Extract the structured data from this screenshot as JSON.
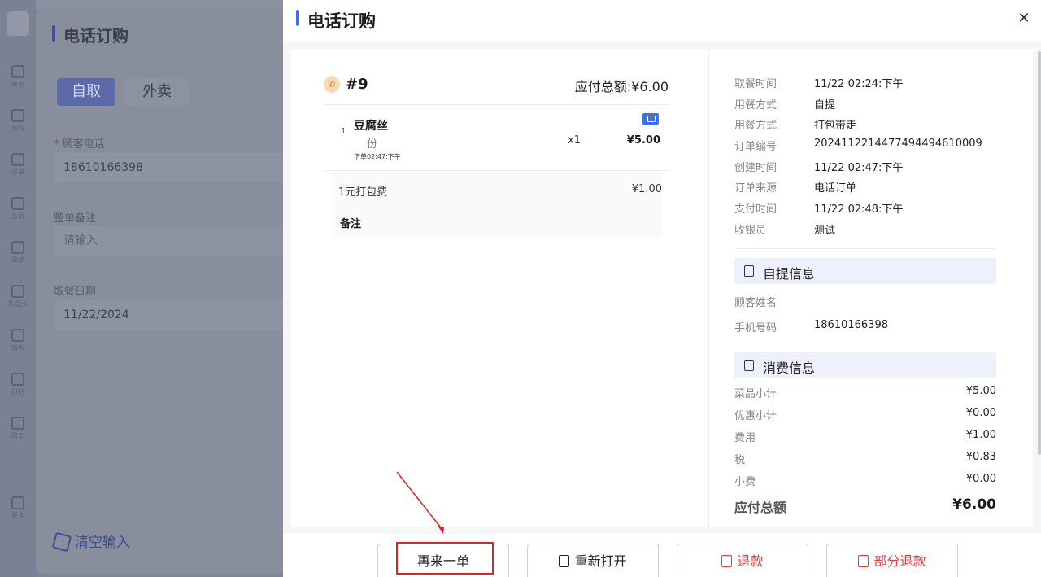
{
  "background": {
    "title": "电话订购",
    "tabs": [
      {
        "label": "自取",
        "active": true
      },
      {
        "label": "外卖",
        "active": false
      }
    ],
    "fields": [
      {
        "label": "顾客电话",
        "required": true,
        "value": "18610166398"
      },
      {
        "label": "整单备注",
        "required": false,
        "placeholder": "请输入"
      },
      {
        "label": "取餐日期",
        "required": false,
        "value": "11/22/2024"
      }
    ],
    "clear_label": "清空输入",
    "rail_items": [
      "桌台",
      "预约",
      "订单",
      "会员",
      "菜单",
      "礼品卡",
      "报表",
      "日结",
      "员工",
      "更多"
    ]
  },
  "modal": {
    "title": "电话订购",
    "close_icon": "close-icon",
    "order": {
      "number": "#9",
      "total_label": "应付总额:¥6.00",
      "items": [
        {
          "index": "1",
          "name": "豆腐丝",
          "unit": "份",
          "time": "下单02:47:下午",
          "qty": "x1",
          "price": "¥5.00",
          "icon": "shopping-bag-icon"
        }
      ],
      "fees": [
        {
          "name": "1元打包费",
          "price": "¥1.00"
        }
      ],
      "note_label": "备注"
    },
    "info": [
      {
        "key": "取餐时间",
        "value": "11/22 02:24:下午"
      },
      {
        "key": "用餐方式",
        "value": "自提"
      },
      {
        "key": "用餐方式",
        "value": "打包带走"
      },
      {
        "key": "订单编号",
        "value": "20241122144774944946​10009"
      },
      {
        "key": "创建时间",
        "value": "11/22 02:47:下午"
      },
      {
        "key": "订单来源",
        "value": "电话订单"
      },
      {
        "key": "支付时间",
        "value": "11/22 02:48:下午"
      },
      {
        "key": "收银员",
        "value": "测试"
      }
    ],
    "pickup_section": {
      "title": "自提信息",
      "rows": [
        {
          "key": "顾客姓名",
          "value": ""
        },
        {
          "key": "手机号码",
          "value": "18610166398"
        }
      ]
    },
    "consumption_section": {
      "title": "消费信息",
      "rows": [
        {
          "key": "菜品小计",
          "value": "¥5.00"
        },
        {
          "key": "优惠小计",
          "value": "¥0.00"
        },
        {
          "key": "费用",
          "value": "¥1.00"
        },
        {
          "key": "税",
          "value": "¥0.83"
        },
        {
          "key": "小费",
          "value": "¥0.00"
        }
      ],
      "total": {
        "key": "应付总额",
        "value": "¥6.00"
      }
    },
    "footer": {
      "reorder": "再来一单",
      "reopen": "重新打开",
      "refund": "退款",
      "partial_refund": "部分退款"
    }
  },
  "colors": {
    "accent": "#3a6ff0",
    "danger": "#e23d3d",
    "annotation": "#e32222"
  }
}
